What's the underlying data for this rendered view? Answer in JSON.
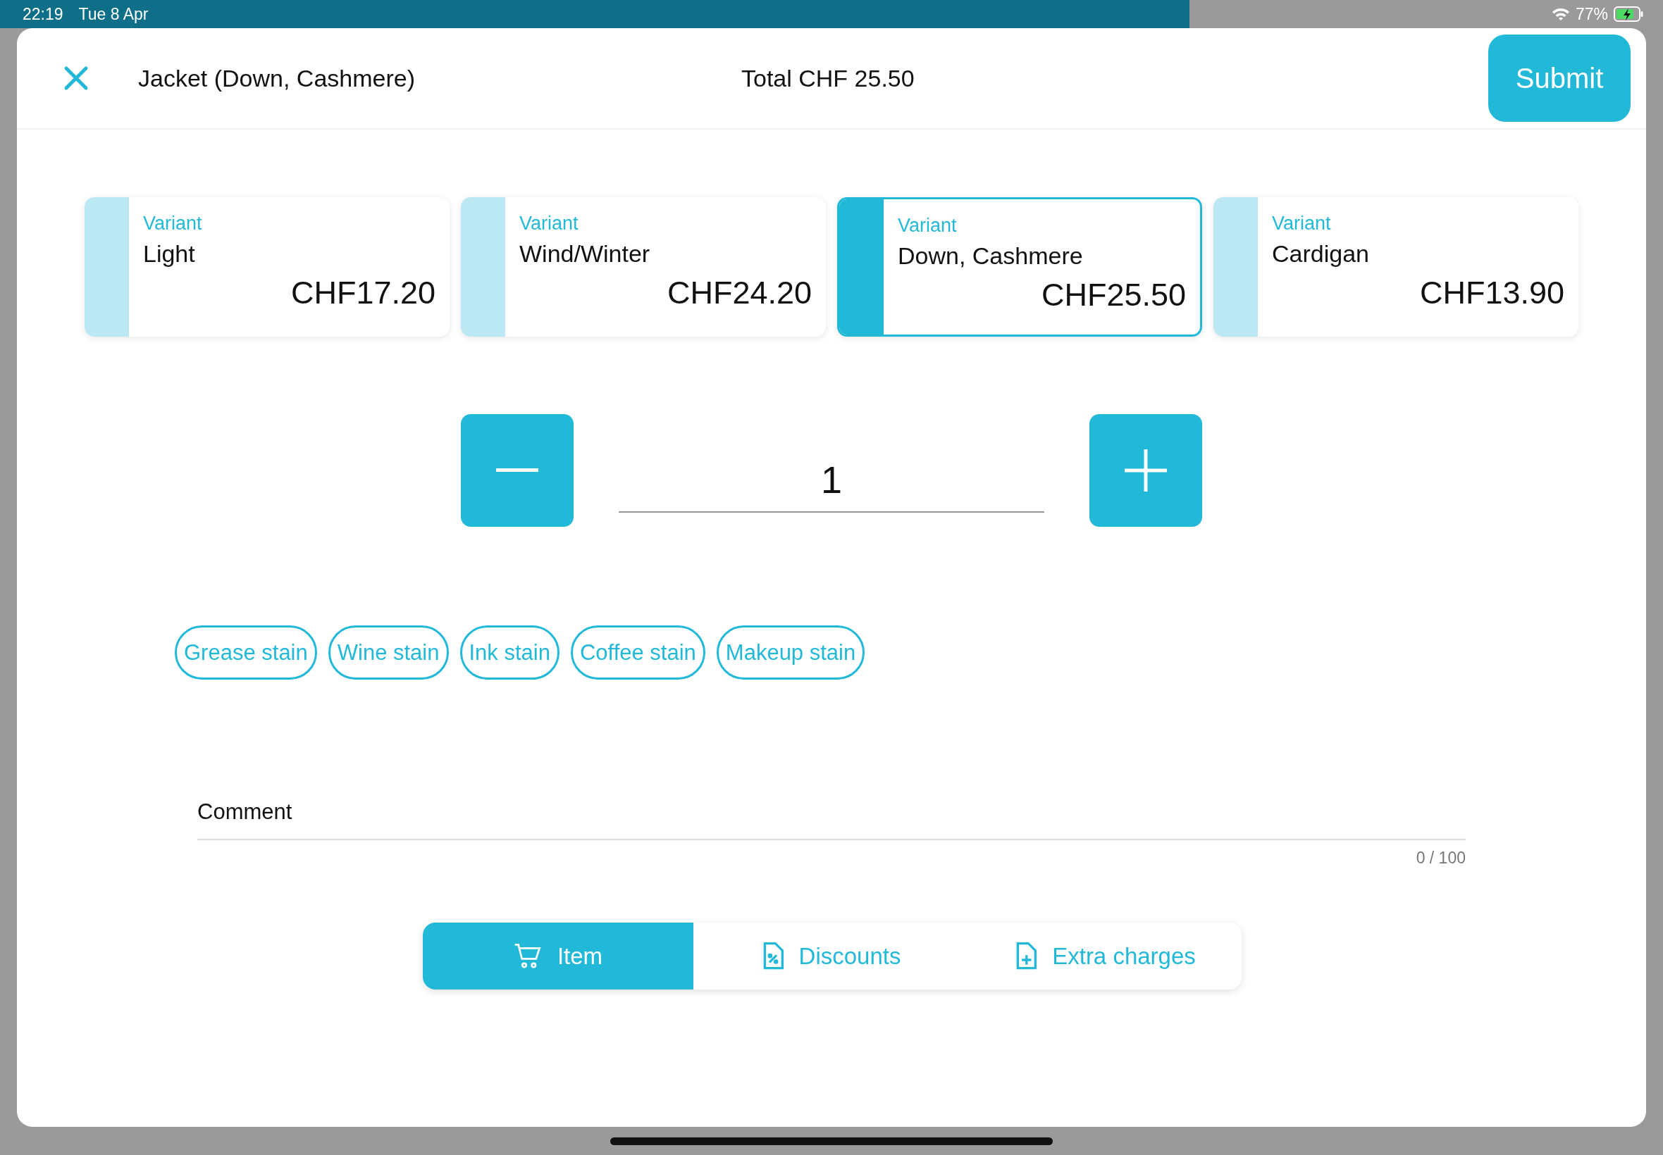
{
  "status_bar": {
    "time": "22:19",
    "date": "Tue 8 Apr",
    "battery": "77%"
  },
  "header": {
    "title": "Jacket (Down, Cashmere)",
    "total": "Total CHF 25.50",
    "submit": "Submit"
  },
  "variants": [
    {
      "label": "Variant",
      "name": "Light",
      "price": "CHF17.20",
      "selected": false
    },
    {
      "label": "Variant",
      "name": "Wind/Winter",
      "price": "CHF24.20",
      "selected": false
    },
    {
      "label": "Variant",
      "name": "Down, Cashmere",
      "price": "CHF25.50",
      "selected": true
    },
    {
      "label": "Variant",
      "name": "Cardigan",
      "price": "CHF13.90",
      "selected": false
    }
  ],
  "quantity": {
    "value": "1"
  },
  "stains": [
    {
      "label": "Grease stain",
      "selected": false
    },
    {
      "label": "Wine stain",
      "selected": false
    },
    {
      "label": "Ink stain",
      "selected": false
    },
    {
      "label": "Coffee stain",
      "selected": false
    },
    {
      "label": "Makeup stain",
      "selected": false
    }
  ],
  "comment": {
    "placeholder": "Comment",
    "counter": "0 / 100"
  },
  "tabs": [
    {
      "kind": "cart",
      "label": "Item",
      "selected": true
    },
    {
      "kind": "discount",
      "label": "Discounts",
      "selected": false
    },
    {
      "kind": "extra",
      "label": "Extra charges",
      "selected": false
    }
  ]
}
